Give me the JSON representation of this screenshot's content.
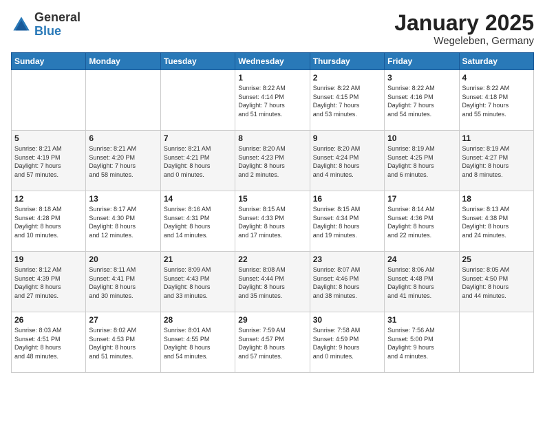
{
  "header": {
    "logo_general": "General",
    "logo_blue": "Blue",
    "month": "January 2025",
    "location": "Wegeleben, Germany"
  },
  "weekdays": [
    "Sunday",
    "Monday",
    "Tuesday",
    "Wednesday",
    "Thursday",
    "Friday",
    "Saturday"
  ],
  "weeks": [
    [
      {
        "day": "",
        "info": ""
      },
      {
        "day": "",
        "info": ""
      },
      {
        "day": "",
        "info": ""
      },
      {
        "day": "1",
        "info": "Sunrise: 8:22 AM\nSunset: 4:14 PM\nDaylight: 7 hours\nand 51 minutes."
      },
      {
        "day": "2",
        "info": "Sunrise: 8:22 AM\nSunset: 4:15 PM\nDaylight: 7 hours\nand 53 minutes."
      },
      {
        "day": "3",
        "info": "Sunrise: 8:22 AM\nSunset: 4:16 PM\nDaylight: 7 hours\nand 54 minutes."
      },
      {
        "day": "4",
        "info": "Sunrise: 8:22 AM\nSunset: 4:18 PM\nDaylight: 7 hours\nand 55 minutes."
      }
    ],
    [
      {
        "day": "5",
        "info": "Sunrise: 8:21 AM\nSunset: 4:19 PM\nDaylight: 7 hours\nand 57 minutes."
      },
      {
        "day": "6",
        "info": "Sunrise: 8:21 AM\nSunset: 4:20 PM\nDaylight: 7 hours\nand 58 minutes."
      },
      {
        "day": "7",
        "info": "Sunrise: 8:21 AM\nSunset: 4:21 PM\nDaylight: 8 hours\nand 0 minutes."
      },
      {
        "day": "8",
        "info": "Sunrise: 8:20 AM\nSunset: 4:23 PM\nDaylight: 8 hours\nand 2 minutes."
      },
      {
        "day": "9",
        "info": "Sunrise: 8:20 AM\nSunset: 4:24 PM\nDaylight: 8 hours\nand 4 minutes."
      },
      {
        "day": "10",
        "info": "Sunrise: 8:19 AM\nSunset: 4:25 PM\nDaylight: 8 hours\nand 6 minutes."
      },
      {
        "day": "11",
        "info": "Sunrise: 8:19 AM\nSunset: 4:27 PM\nDaylight: 8 hours\nand 8 minutes."
      }
    ],
    [
      {
        "day": "12",
        "info": "Sunrise: 8:18 AM\nSunset: 4:28 PM\nDaylight: 8 hours\nand 10 minutes."
      },
      {
        "day": "13",
        "info": "Sunrise: 8:17 AM\nSunset: 4:30 PM\nDaylight: 8 hours\nand 12 minutes."
      },
      {
        "day": "14",
        "info": "Sunrise: 8:16 AM\nSunset: 4:31 PM\nDaylight: 8 hours\nand 14 minutes."
      },
      {
        "day": "15",
        "info": "Sunrise: 8:15 AM\nSunset: 4:33 PM\nDaylight: 8 hours\nand 17 minutes."
      },
      {
        "day": "16",
        "info": "Sunrise: 8:15 AM\nSunset: 4:34 PM\nDaylight: 8 hours\nand 19 minutes."
      },
      {
        "day": "17",
        "info": "Sunrise: 8:14 AM\nSunset: 4:36 PM\nDaylight: 8 hours\nand 22 minutes."
      },
      {
        "day": "18",
        "info": "Sunrise: 8:13 AM\nSunset: 4:38 PM\nDaylight: 8 hours\nand 24 minutes."
      }
    ],
    [
      {
        "day": "19",
        "info": "Sunrise: 8:12 AM\nSunset: 4:39 PM\nDaylight: 8 hours\nand 27 minutes."
      },
      {
        "day": "20",
        "info": "Sunrise: 8:11 AM\nSunset: 4:41 PM\nDaylight: 8 hours\nand 30 minutes."
      },
      {
        "day": "21",
        "info": "Sunrise: 8:09 AM\nSunset: 4:43 PM\nDaylight: 8 hours\nand 33 minutes."
      },
      {
        "day": "22",
        "info": "Sunrise: 8:08 AM\nSunset: 4:44 PM\nDaylight: 8 hours\nand 35 minutes."
      },
      {
        "day": "23",
        "info": "Sunrise: 8:07 AM\nSunset: 4:46 PM\nDaylight: 8 hours\nand 38 minutes."
      },
      {
        "day": "24",
        "info": "Sunrise: 8:06 AM\nSunset: 4:48 PM\nDaylight: 8 hours\nand 41 minutes."
      },
      {
        "day": "25",
        "info": "Sunrise: 8:05 AM\nSunset: 4:50 PM\nDaylight: 8 hours\nand 44 minutes."
      }
    ],
    [
      {
        "day": "26",
        "info": "Sunrise: 8:03 AM\nSunset: 4:51 PM\nDaylight: 8 hours\nand 48 minutes."
      },
      {
        "day": "27",
        "info": "Sunrise: 8:02 AM\nSunset: 4:53 PM\nDaylight: 8 hours\nand 51 minutes."
      },
      {
        "day": "28",
        "info": "Sunrise: 8:01 AM\nSunset: 4:55 PM\nDaylight: 8 hours\nand 54 minutes."
      },
      {
        "day": "29",
        "info": "Sunrise: 7:59 AM\nSunset: 4:57 PM\nDaylight: 8 hours\nand 57 minutes."
      },
      {
        "day": "30",
        "info": "Sunrise: 7:58 AM\nSunset: 4:59 PM\nDaylight: 9 hours\nand 0 minutes."
      },
      {
        "day": "31",
        "info": "Sunrise: 7:56 AM\nSunset: 5:00 PM\nDaylight: 9 hours\nand 4 minutes."
      },
      {
        "day": "",
        "info": ""
      }
    ]
  ]
}
